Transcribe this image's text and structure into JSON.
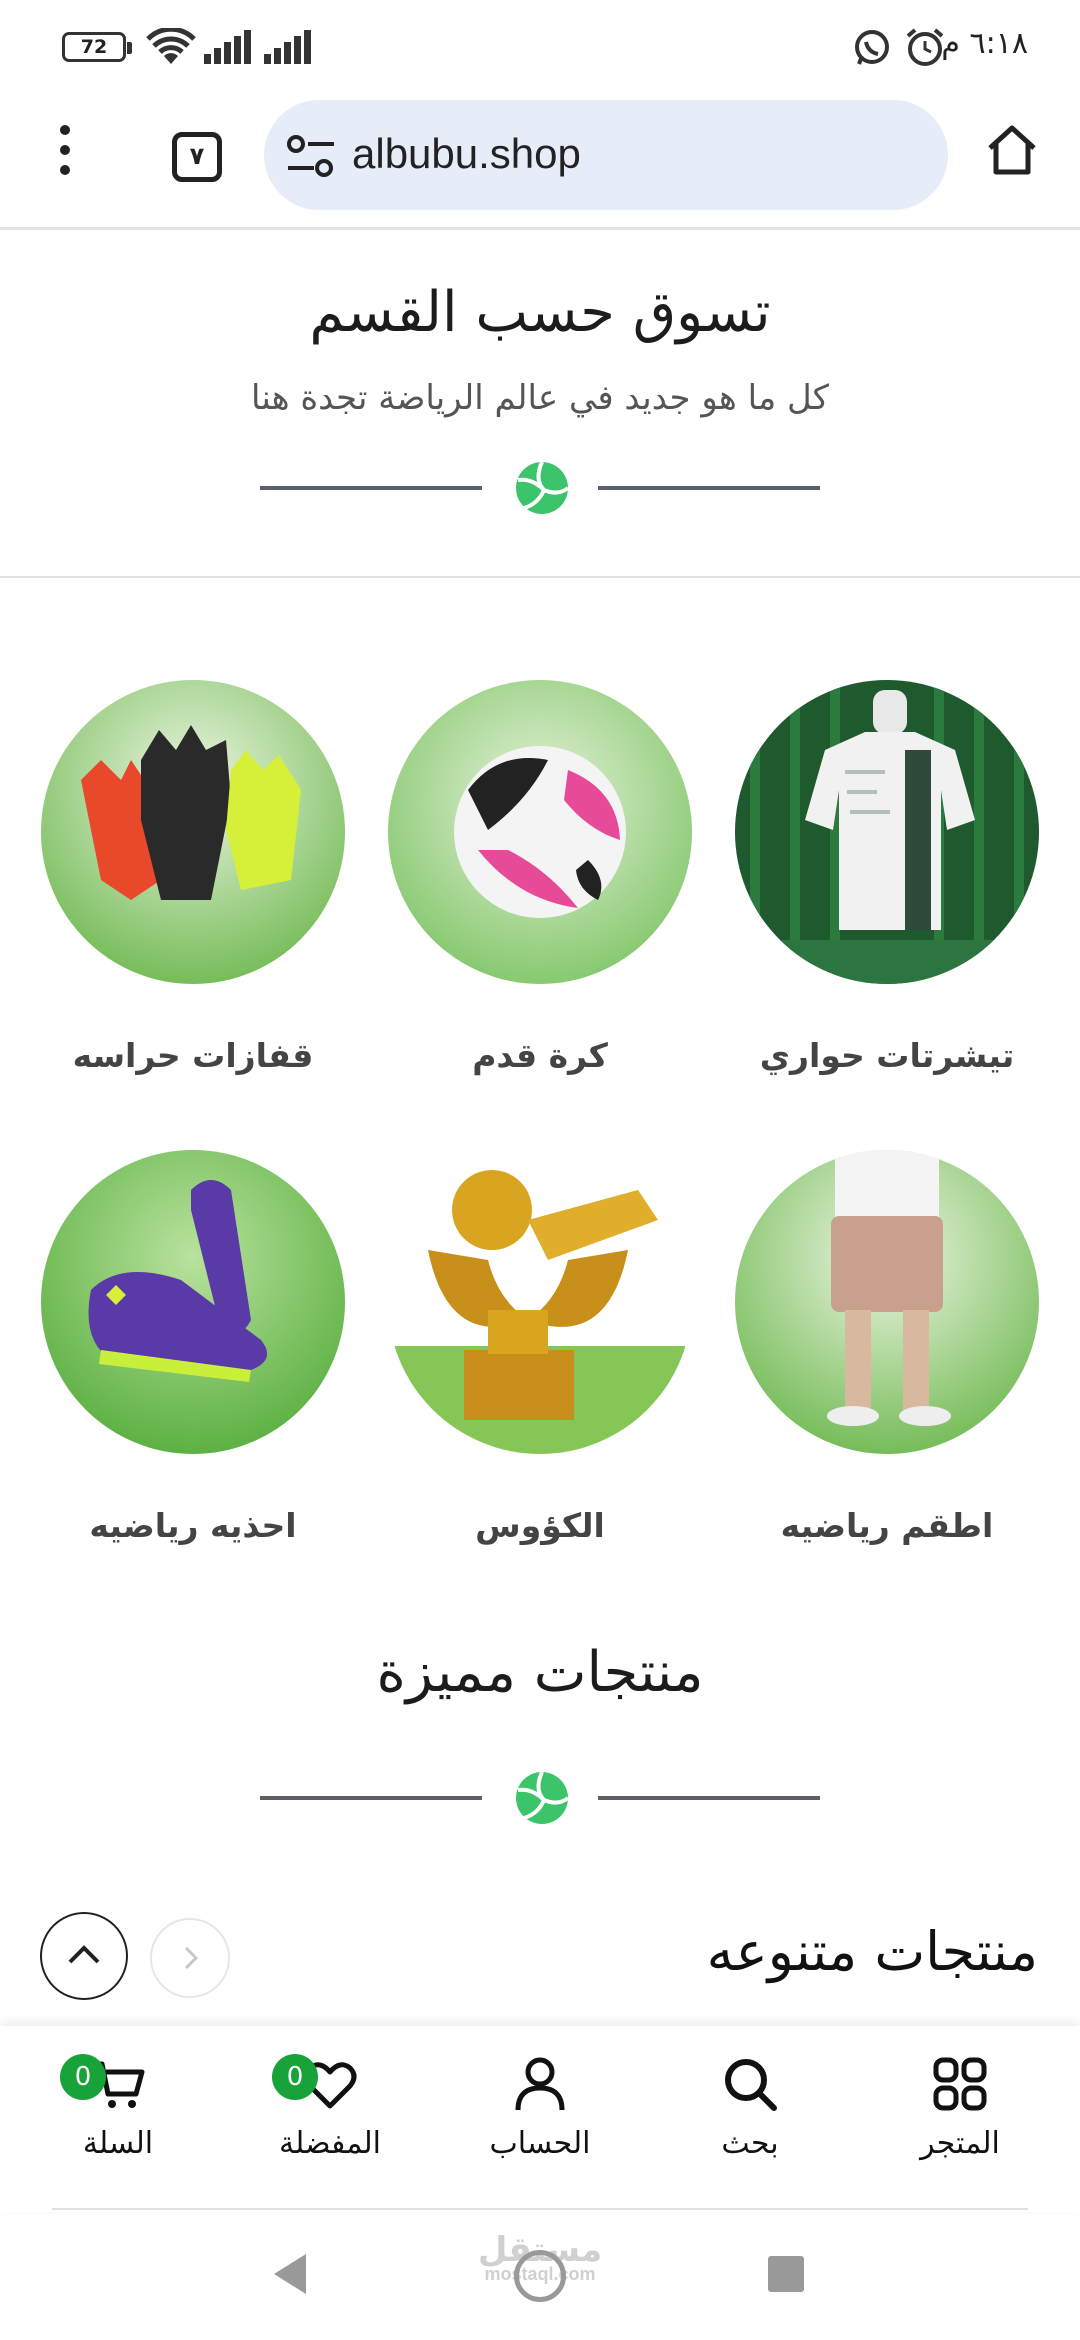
{
  "status_bar": {
    "battery": "72",
    "time": "٦:١٨ م"
  },
  "browser": {
    "tab_count": "٧",
    "url": "albubu.shop"
  },
  "shop_by_section": {
    "title": "تسوق حسب القسم",
    "subtitle": "كل ما هو جديد في عالم الرياضة تجدة هنا"
  },
  "categories": [
    {
      "label": "تيشرتات حواري",
      "icon": "jersey-image"
    },
    {
      "label": "كرة قدم",
      "icon": "football-image"
    },
    {
      "label": "قفازات حراسه",
      "icon": "goalkeeper-gloves-image"
    },
    {
      "label": "اطقم رياضيه",
      "icon": "sport-outfit-image"
    },
    {
      "label": "الكؤوس",
      "icon": "trophy-image"
    },
    {
      "label": "احذيه رياضيه",
      "icon": "sport-shoes-image"
    }
  ],
  "featured": {
    "title": "منتجات مميزة"
  },
  "assorted": {
    "title": "منتجات متنوعه"
  },
  "bottom_nav": {
    "items": [
      {
        "label": "المتجر",
        "icon": "grid-icon"
      },
      {
        "label": "بحث",
        "icon": "search-icon"
      },
      {
        "label": "الحساب",
        "icon": "user-icon"
      },
      {
        "label": "المفضلة",
        "icon": "heart-icon",
        "badge": "0"
      },
      {
        "label": "السلة",
        "icon": "cart-icon",
        "badge": "0"
      }
    ]
  },
  "watermark": {
    "text": "مستقل",
    "sub": "mostaql.com"
  },
  "colors": {
    "accent_green": "#18a23a",
    "url_bar": "#e7edf8"
  }
}
